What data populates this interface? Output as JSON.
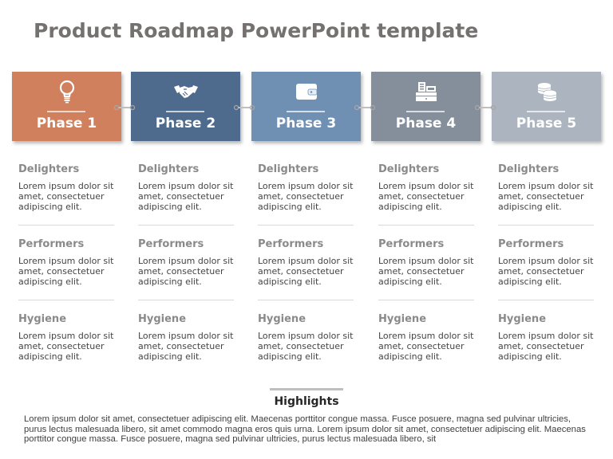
{
  "title": "Product Roadmap PowerPoint template",
  "phases": [
    {
      "label": "Phase 1",
      "icon": "lightbulb-icon",
      "color": "#D1805E"
    },
    {
      "label": "Phase 2",
      "icon": "handshake-icon",
      "color": "#4E6A8C"
    },
    {
      "label": "Phase 3",
      "icon": "wallet-icon",
      "color": "#7090B3"
    },
    {
      "label": "Phase 4",
      "icon": "cash-register-icon",
      "color": "#858F9C"
    },
    {
      "label": "Phase 5",
      "icon": "coins-icon",
      "color": "#ACB5BF"
    }
  ],
  "columns": [
    {
      "sections": [
        {
          "title": "Delighters",
          "body": "Lorem ipsum dolor sit amet, consectetuer adipiscing elit."
        },
        {
          "title": "Performers",
          "body": "Lorem ipsum dolor sit amet, consectetuer adipiscing elit."
        },
        {
          "title": "Hygiene",
          "body": "Lorem ipsum dolor sit amet, consectetuer adipiscing elit."
        }
      ]
    },
    {
      "sections": [
        {
          "title": "Delighters",
          "body": "Lorem ipsum dolor sit amet, consectetuer adipiscing elit."
        },
        {
          "title": "Performers",
          "body": "Lorem ipsum dolor sit amet, consectetuer adipiscing elit."
        },
        {
          "title": "Hygiene",
          "body": "Lorem ipsum dolor sit amet, consectetuer adipiscing elit."
        }
      ]
    },
    {
      "sections": [
        {
          "title": "Delighters",
          "body": "Lorem ipsum dolor sit amet, consectetuer adipiscing elit."
        },
        {
          "title": "Performers",
          "body": "Lorem ipsum dolor sit amet, consectetuer adipiscing elit."
        },
        {
          "title": "Hygiene",
          "body": "Lorem ipsum dolor sit amet, consectetuer adipiscing elit."
        }
      ]
    },
    {
      "sections": [
        {
          "title": "Delighters",
          "body": "Lorem ipsum dolor sit amet, consectetuer adipiscing elit."
        },
        {
          "title": "Performers",
          "body": "Lorem ipsum dolor sit amet, consectetuer adipiscing elit."
        },
        {
          "title": "Hygiene",
          "body": "Lorem ipsum dolor sit amet, consectetuer adipiscing elit."
        }
      ]
    },
    {
      "sections": [
        {
          "title": "Delighters",
          "body": "Lorem ipsum dolor sit amet, consectetuer adipiscing elit."
        },
        {
          "title": "Performers",
          "body": "Lorem ipsum dolor sit amet, consectetuer adipiscing elit."
        },
        {
          "title": "Hygiene",
          "body": "Lorem ipsum dolor sit amet, consectetuer adipiscing elit."
        }
      ]
    }
  ],
  "highlights": {
    "title": "Highlights",
    "body": "Lorem ipsum dolor sit amet, consectetuer adipiscing elit. Maecenas porttitor congue massa. Fusce posuere, magna sed pulvinar ultricies, purus lectus malesuada libero, sit amet commodo magna eros quis urna. Lorem ipsum dolor sit amet, consectetuer adipiscing elit. Maecenas porttitor congue massa. Fusce posuere, magna sed pulvinar ultricies, purus lectus malesuada libero, sit"
  }
}
